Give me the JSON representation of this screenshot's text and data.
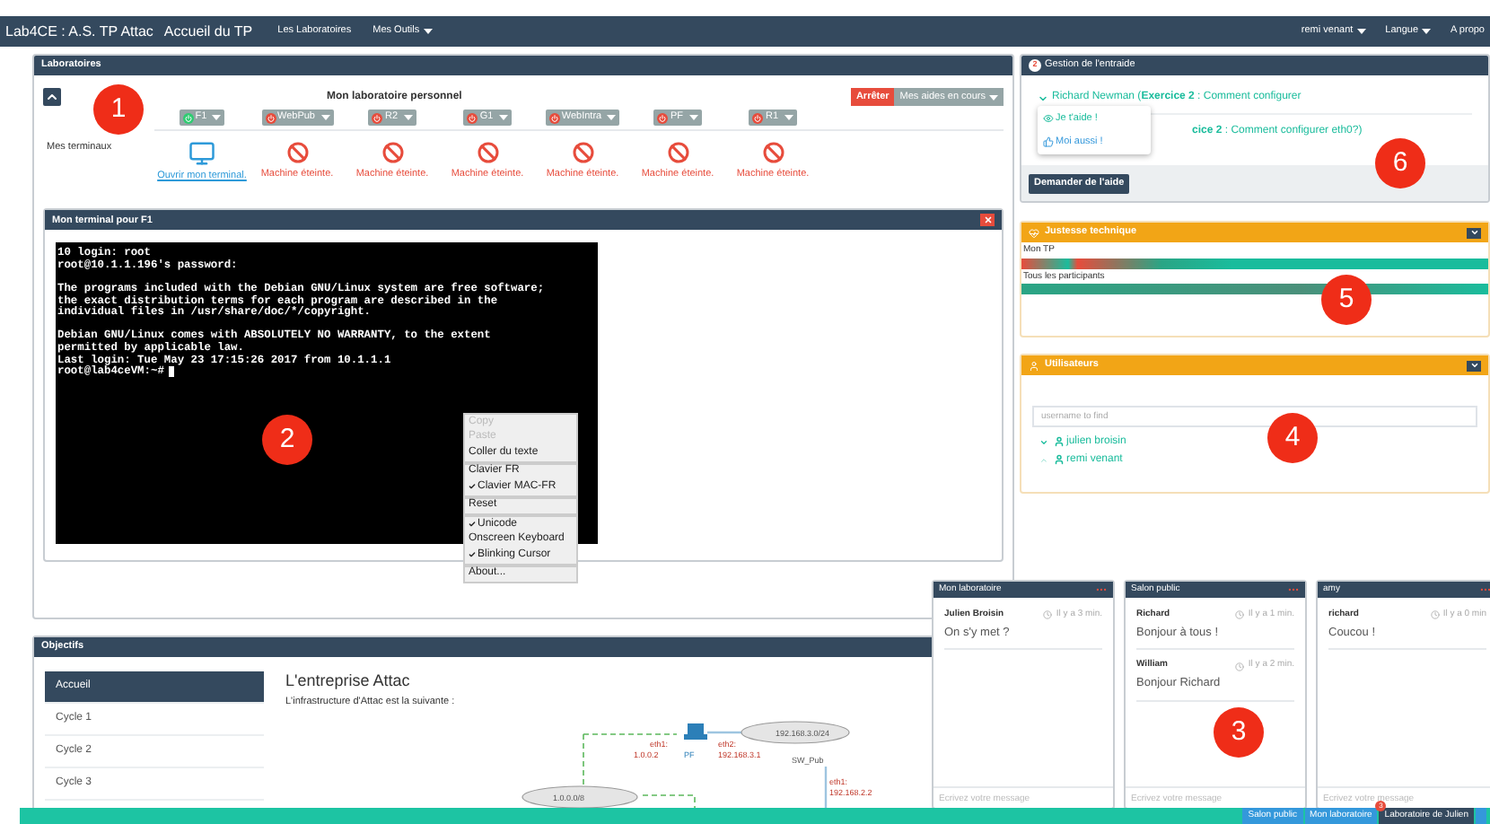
{
  "navbar": {
    "brand": "Lab4CE : A.S. TP Attac",
    "items": [
      {
        "label": "Accueil du TP",
        "kind": "link"
      },
      {
        "label": "Les Laboratoires",
        "kind": "link"
      },
      {
        "label": "Mes Outils",
        "kind": "dropdown"
      }
    ],
    "right_items": [
      {
        "label": "remi venant",
        "kind": "dropdown"
      },
      {
        "label": "Langue",
        "kind": "dropdown"
      },
      {
        "label": "A propo",
        "kind": "link"
      }
    ]
  },
  "laboratoires": {
    "title": "Laboratoires",
    "expanded": true,
    "heading": "Mon laboratoire personnel",
    "stop_button": "Arrêter",
    "help_menu": "Mes aides en cours",
    "row_label": "Mes terminaux",
    "machines": [
      {
        "name": "F1",
        "on": true,
        "status": "Ouvrir mon terminal."
      },
      {
        "name": "WebPub",
        "on": false,
        "status": "Machine éteinte."
      },
      {
        "name": "R2",
        "on": false,
        "status": "Machine éteinte."
      },
      {
        "name": "G1",
        "on": false,
        "status": "Machine éteinte."
      },
      {
        "name": "WebIntra",
        "on": false,
        "status": "Machine éteinte."
      },
      {
        "name": "PF",
        "on": false,
        "status": "Machine éteinte."
      },
      {
        "name": "R1",
        "on": false,
        "status": "Machine éteinte."
      }
    ]
  },
  "terminal": {
    "title": "Mon terminal pour F1",
    "paragraphs": [
      [
        "10 login: root",
        "root@10.1.1.196's password:"
      ],
      [
        "The programs included with the Debian GNU/Linux system are free software;",
        "the exact distribution terms for each program are described in the",
        "individual files in /usr/share/doc/*/copyright."
      ],
      [
        "Debian GNU/Linux comes with ABSOLUTELY NO WARRANTY, to the extent",
        "permitted by applicable law.",
        "Last login: Tue May 23 17:15:26 2017 from 10.1.1.1",
        "root@lab4ceVM:~#"
      ]
    ],
    "context_menu": [
      [
        {
          "label": "Copy",
          "disabled": true,
          "checked": false
        },
        {
          "label": "Paste",
          "disabled": true,
          "checked": false
        },
        {
          "label": "Coller du texte",
          "disabled": false,
          "checked": false
        }
      ],
      [
        {
          "label": "Clavier FR",
          "disabled": false,
          "checked": false
        },
        {
          "label": "Clavier MAC-FR",
          "disabled": false,
          "checked": true
        }
      ],
      [
        {
          "label": "Reset",
          "disabled": false,
          "checked": false
        }
      ],
      [
        {
          "label": "Unicode",
          "disabled": false,
          "checked": true
        },
        {
          "label": "Onscreen Keyboard",
          "disabled": false,
          "checked": false
        },
        {
          "label": "Blinking Cursor",
          "disabled": false,
          "checked": true
        }
      ],
      [
        {
          "label": "About...",
          "disabled": false,
          "checked": false
        }
      ]
    ]
  },
  "objectifs": {
    "title": "Objectifs",
    "nav": [
      {
        "label": "Accueil",
        "selected": true
      },
      {
        "label": "Cycle 1",
        "selected": false
      },
      {
        "label": "Cycle 2",
        "selected": false
      },
      {
        "label": "Cycle 3",
        "selected": false
      }
    ],
    "heading": "L'entreprise Attac",
    "intro": "L'infrastructure d'Attac est la suivante :",
    "diagram_labels": [
      "192.168.3.0/24",
      "eth1:",
      "eth2:",
      "1.0.0.2",
      "PF",
      "192.168.3.1",
      "SW_Pub",
      "eth1:",
      "192.168.2.2",
      "1.0.0.0/8"
    ]
  },
  "entraide": {
    "title": "Gestion de l'entraide",
    "badge": "2",
    "requests": [
      {
        "text": "Richard Newman (**Exercice 2** : Comment configurer",
        "expanded": true
      },
      {
        "text": "**cice 2** : Comment configurer eth0?)"
      }
    ],
    "popover": [
      {
        "label": "Je t'aide !",
        "kind": "help"
      },
      {
        "label": "Moi aussi !",
        "kind": "like"
      }
    ],
    "button": "Demander de l'aide"
  },
  "justesse": {
    "title": "Justesse technique",
    "bars": [
      {
        "label": "Mon TP",
        "kind": "mixed"
      },
      {
        "label": "Tous les participants",
        "kind": "good"
      }
    ]
  },
  "utilisateurs": {
    "title": "Utilisateurs",
    "search": {
      "placeholder": "username to find"
    },
    "users": [
      {
        "name": "julien broisin",
        "expanded": true
      },
      {
        "name": "remi venant",
        "expanded": false
      }
    ]
  },
  "chats": [
    {
      "title": "Mon laboratoire",
      "messages": [
        {
          "author": "Julien Broisin",
          "time": "Il y a 3 min.",
          "text": "On s'y met ?"
        }
      ],
      "placeholder": "Ecrivez votre message"
    },
    {
      "title": "Salon public",
      "messages": [
        {
          "author": "Richard",
          "time": "Il y a 1 min.",
          "text": "Bonjour à tous !"
        },
        {
          "author": "William",
          "time": "Il y a 2 min.",
          "text": "Bonjour Richard"
        }
      ],
      "placeholder": "Ecrivez votre message"
    },
    {
      "title": "amy",
      "messages": [
        {
          "author": "richard",
          "time": "Il y a 0 min",
          "text": "Coucou !"
        }
      ],
      "placeholder": "Ecrivez votre message"
    }
  ],
  "bottom_bar": [
    {
      "label": "Salon public",
      "selected": false
    },
    {
      "label": "Mon laboratoire",
      "selected": false
    },
    {
      "label": "Laboratoire de Julien",
      "selected": true,
      "badge": "3"
    }
  ],
  "callouts": [
    "1",
    "2",
    "3",
    "4",
    "5",
    "6"
  ]
}
